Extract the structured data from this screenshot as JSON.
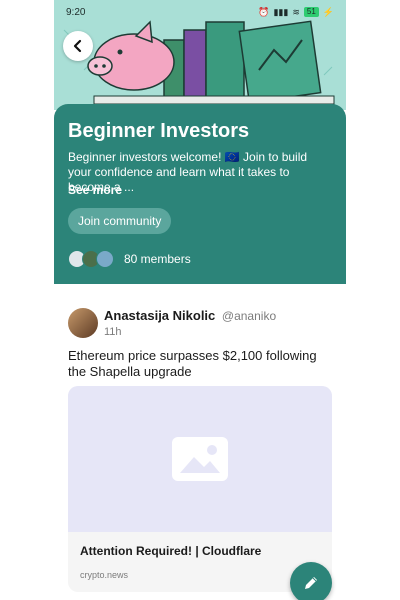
{
  "status_bar": {
    "time": "9:20",
    "battery": "51"
  },
  "community": {
    "title": "Beginner Investors",
    "description": "Beginner investors welcome! 🇪🇺 Join to build your confidence and learn what it takes to become a ...",
    "see_more": "See more",
    "join_label": "Join community",
    "members_label": "80 members"
  },
  "post": {
    "author_name": "Anastasija Nikolic",
    "handle": "@ananiko",
    "time": "11h",
    "text": "Ethereum price surpasses $2,100 following the Shapella upgrade",
    "link": {
      "title": "Attention Required! | Cloudflare",
      "domain": "crypto.news"
    }
  },
  "colors": {
    "brand": "#2c8479",
    "banner": "#a9dfd6",
    "join_button": "#5ba69d",
    "placeholder_bg": "#e6e6f7"
  },
  "icons": {
    "back": "arrow-left-icon",
    "image_placeholder": "image-icon",
    "compose": "pencil-icon"
  }
}
